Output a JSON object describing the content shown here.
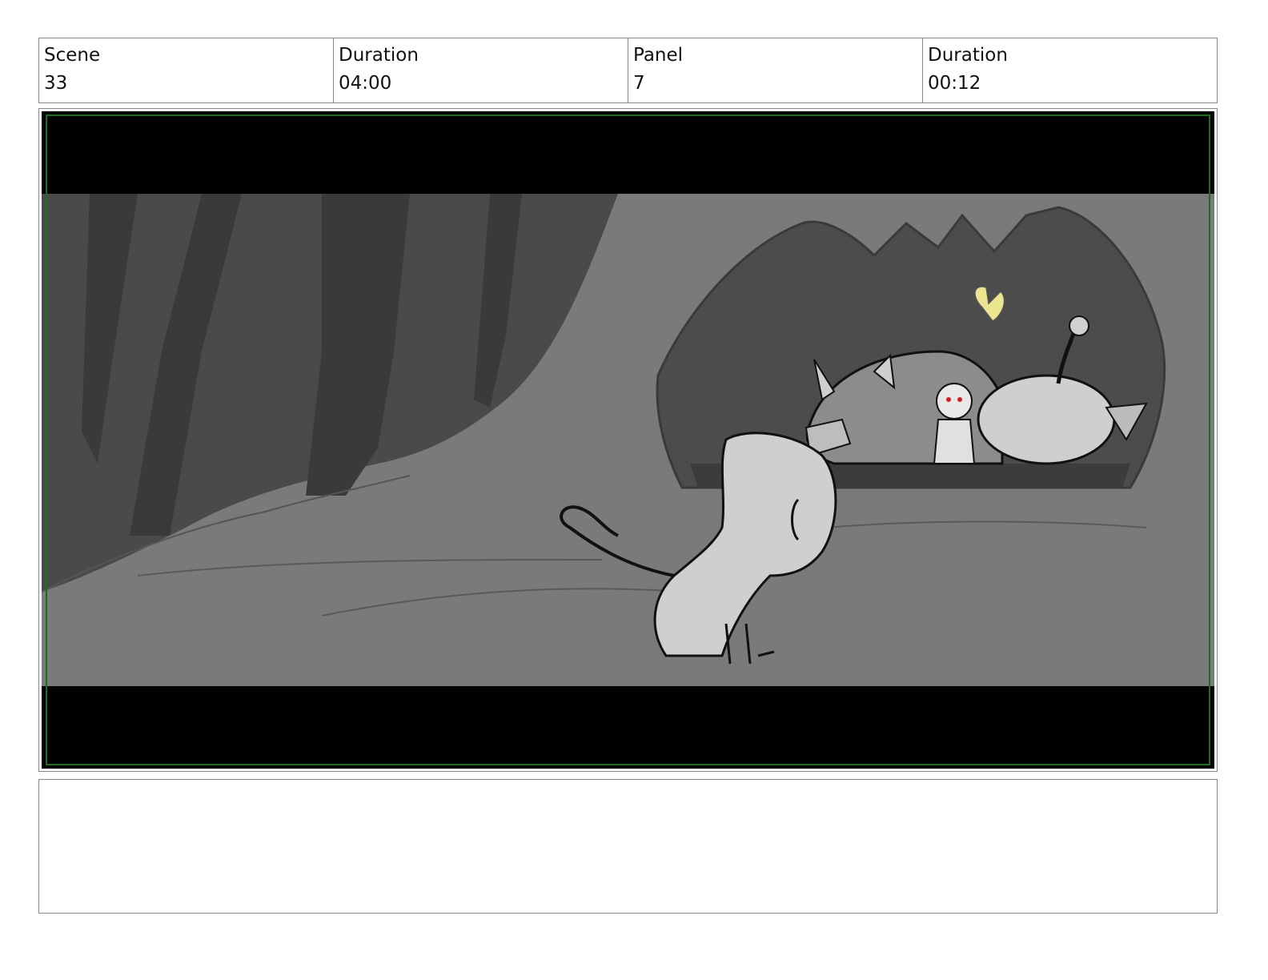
{
  "header": {
    "scene_label": "Scene",
    "scene_value": "33",
    "scene_duration_label": "Duration",
    "scene_duration_value": "04:00",
    "panel_label": "Panel",
    "panel_value": "7",
    "panel_duration_label": "Duration",
    "panel_duration_value": "00:12"
  },
  "panel_image": {
    "description_icon": "storyboard-sketch",
    "colors": {
      "letterbox": "#000000",
      "safe_frame": "#1f6e1f",
      "butterfly": "#ece58f",
      "eyes": "#d42020"
    }
  },
  "notes": {
    "text": ""
  }
}
